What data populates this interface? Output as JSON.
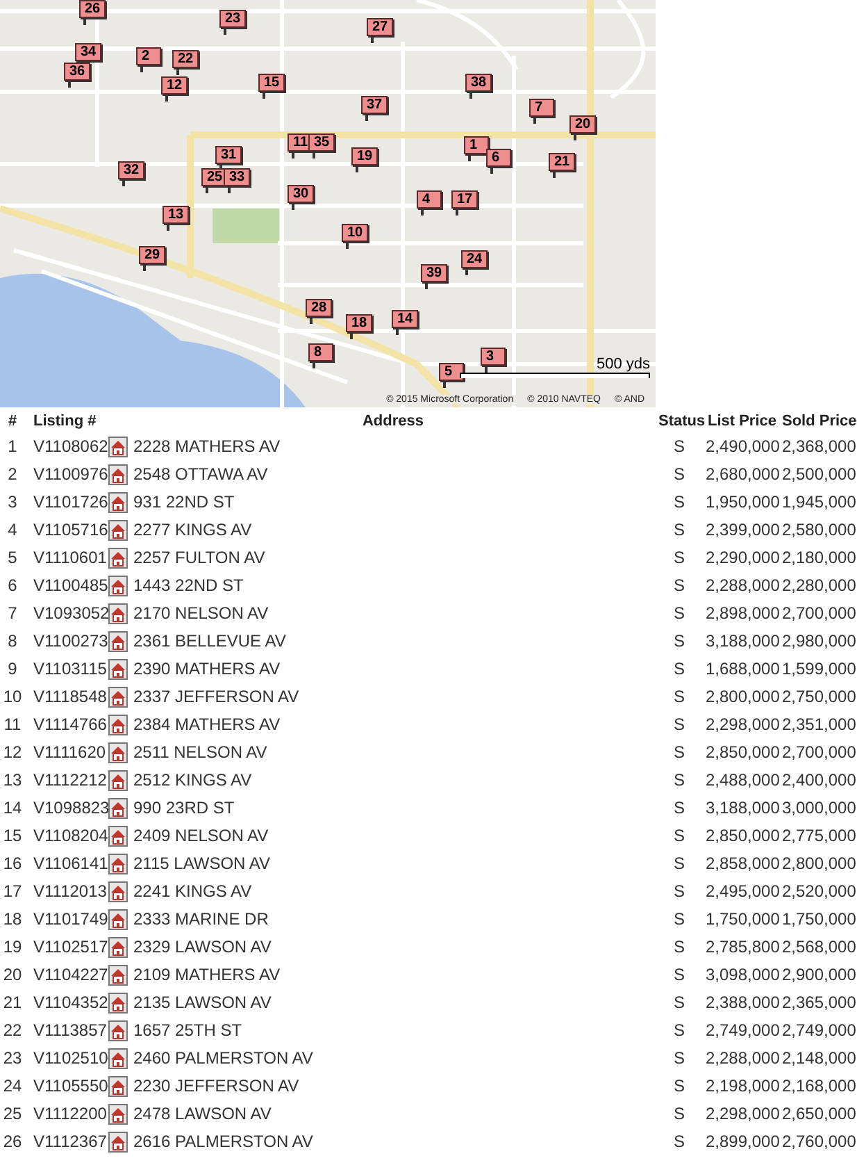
{
  "map": {
    "pins": [
      {
        "label": "26"
      },
      {
        "label": "23"
      },
      {
        "label": "27"
      },
      {
        "label": "34"
      },
      {
        "label": "2"
      },
      {
        "label": "22"
      },
      {
        "label": "36"
      },
      {
        "label": "12"
      },
      {
        "label": "15"
      },
      {
        "label": "38"
      },
      {
        "label": "37"
      },
      {
        "label": "7"
      },
      {
        "label": "20"
      },
      {
        "label": "11"
      },
      {
        "label": "35"
      },
      {
        "label": "1"
      },
      {
        "label": "31"
      },
      {
        "label": "19"
      },
      {
        "label": "6"
      },
      {
        "label": "21"
      },
      {
        "label": "32"
      },
      {
        "label": "25"
      },
      {
        "label": "33"
      },
      {
        "label": "30"
      },
      {
        "label": "4"
      },
      {
        "label": "17"
      },
      {
        "label": "13"
      },
      {
        "label": "10"
      },
      {
        "label": "29"
      },
      {
        "label": "24"
      },
      {
        "label": "39"
      },
      {
        "label": "28"
      },
      {
        "label": "14"
      },
      {
        "label": "18"
      },
      {
        "label": "8"
      },
      {
        "label": "3"
      },
      {
        "label": "5"
      }
    ],
    "scale": "500 yds",
    "copyright": [
      "© 2015 Microsoft Corporation",
      "© 2010 NAVTEQ",
      "© AND"
    ]
  },
  "table": {
    "columns": [
      "#",
      "Listing #",
      "Address",
      "Status",
      "List Price",
      "Sold Price"
    ],
    "rows": [
      {
        "num": "1",
        "listing": "V1108062",
        "address": "2228 MATHERS AV",
        "status": "S",
        "list_price": "2,490,000",
        "sold_price": "2,368,000"
      },
      {
        "num": "2",
        "listing": "V1100976",
        "address": "2548 OTTAWA AV",
        "status": "S",
        "list_price": "2,680,000",
        "sold_price": "2,500,000"
      },
      {
        "num": "3",
        "listing": "V1101726",
        "address": "931 22ND ST",
        "status": "S",
        "list_price": "1,950,000",
        "sold_price": "1,945,000"
      },
      {
        "num": "4",
        "listing": "V1105716",
        "address": "2277 KINGS AV",
        "status": "S",
        "list_price": "2,399,000",
        "sold_price": "2,580,000"
      },
      {
        "num": "5",
        "listing": "V1110601",
        "address": "2257 FULTON AV",
        "status": "S",
        "list_price": "2,290,000",
        "sold_price": "2,180,000"
      },
      {
        "num": "6",
        "listing": "V1100485",
        "address": "1443 22ND ST",
        "status": "S",
        "list_price": "2,288,000",
        "sold_price": "2,280,000"
      },
      {
        "num": "7",
        "listing": "V1093052",
        "address": "2170 NELSON AV",
        "status": "S",
        "list_price": "2,898,000",
        "sold_price": "2,700,000"
      },
      {
        "num": "8",
        "listing": "V1100273",
        "address": "2361 BELLEVUE AV",
        "status": "S",
        "list_price": "3,188,000",
        "sold_price": "2,980,000"
      },
      {
        "num": "9",
        "listing": "V1103115",
        "address": "2390 MATHERS AV",
        "status": "S",
        "list_price": "1,688,000",
        "sold_price": "1,599,000"
      },
      {
        "num": "10",
        "listing": "V1118548",
        "address": "2337 JEFFERSON AV",
        "status": "S",
        "list_price": "2,800,000",
        "sold_price": "2,750,000"
      },
      {
        "num": "11",
        "listing": "V1114766",
        "address": "2384 MATHERS AV",
        "status": "S",
        "list_price": "2,298,000",
        "sold_price": "2,351,000"
      },
      {
        "num": "12",
        "listing": "V1111620",
        "address": "2511 NELSON AV",
        "status": "S",
        "list_price": "2,850,000",
        "sold_price": "2,700,000"
      },
      {
        "num": "13",
        "listing": "V1112212",
        "address": "2512 KINGS AV",
        "status": "S",
        "list_price": "2,488,000",
        "sold_price": "2,400,000"
      },
      {
        "num": "14",
        "listing": "V1098823",
        "address": "990 23RD ST",
        "status": "S",
        "list_price": "3,188,000",
        "sold_price": "3,000,000"
      },
      {
        "num": "15",
        "listing": "V1108204",
        "address": "2409 NELSON AV",
        "status": "S",
        "list_price": "2,850,000",
        "sold_price": "2,775,000"
      },
      {
        "num": "16",
        "listing": "V1106141",
        "address": "2115 LAWSON AV",
        "status": "S",
        "list_price": "2,858,000",
        "sold_price": "2,800,000"
      },
      {
        "num": "17",
        "listing": "V1112013",
        "address": "2241 KINGS AV",
        "status": "S",
        "list_price": "2,495,000",
        "sold_price": "2,520,000"
      },
      {
        "num": "18",
        "listing": "V1101749",
        "address": "2333 MARINE DR",
        "status": "S",
        "list_price": "1,750,000",
        "sold_price": "1,750,000"
      },
      {
        "num": "19",
        "listing": "V1102517",
        "address": "2329 LAWSON AV",
        "status": "S",
        "list_price": "2,785,800",
        "sold_price": "2,568,000"
      },
      {
        "num": "20",
        "listing": "V1104227",
        "address": "2109 MATHERS AV",
        "status": "S",
        "list_price": "3,098,000",
        "sold_price": "2,900,000"
      },
      {
        "num": "21",
        "listing": "V1104352",
        "address": "2135 LAWSON AV",
        "status": "S",
        "list_price": "2,388,000",
        "sold_price": "2,365,000"
      },
      {
        "num": "22",
        "listing": "V1113857",
        "address": "1657 25TH ST",
        "status": "S",
        "list_price": "2,749,000",
        "sold_price": "2,749,000"
      },
      {
        "num": "23",
        "listing": "V1102510",
        "address": "2460 PALMERSTON AV",
        "status": "S",
        "list_price": "2,288,000",
        "sold_price": "2,148,000"
      },
      {
        "num": "24",
        "listing": "V1105550",
        "address": "2230 JEFFERSON AV",
        "status": "S",
        "list_price": "2,198,000",
        "sold_price": "2,168,000"
      },
      {
        "num": "25",
        "listing": "V1112200",
        "address": "2478 LAWSON AV",
        "status": "S",
        "list_price": "2,298,000",
        "sold_price": "2,650,000"
      },
      {
        "num": "26",
        "listing": "V1112367",
        "address": "2616 PALMERSTON AV",
        "status": "S",
        "list_price": "2,899,000",
        "sold_price": "2,760,000"
      }
    ]
  }
}
